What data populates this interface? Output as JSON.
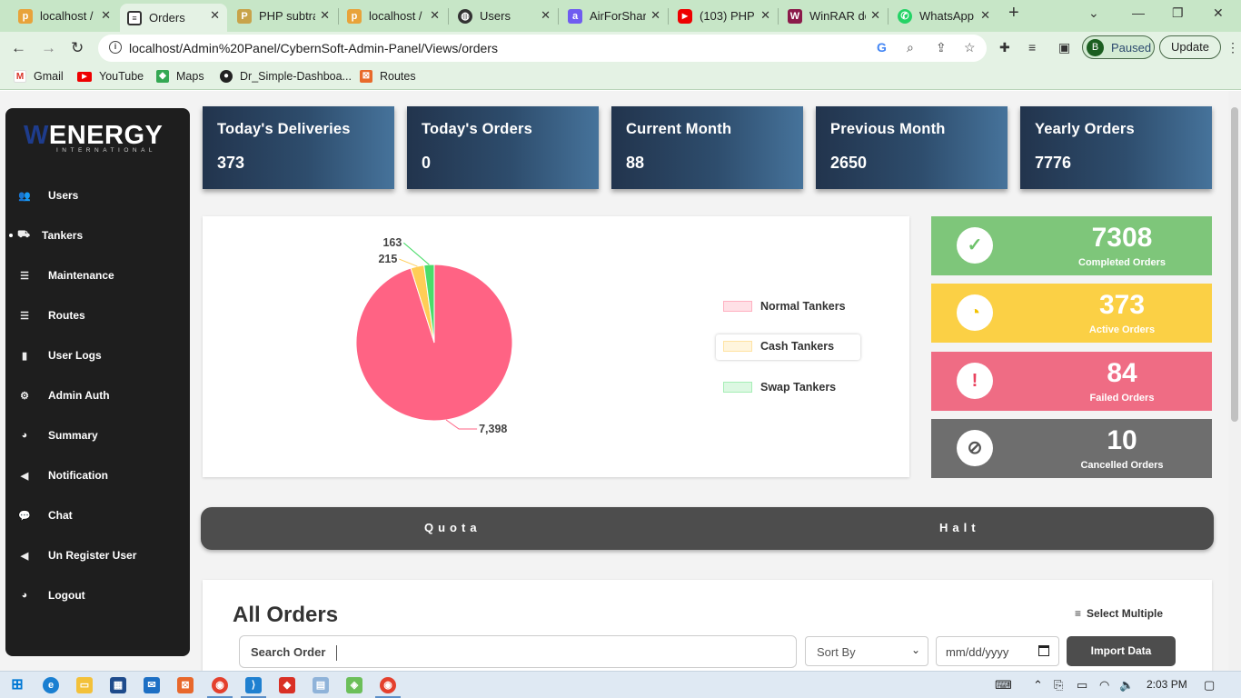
{
  "browser": {
    "tabs": [
      {
        "title": "localhost /",
        "icon": "phpmyadmin-icon"
      },
      {
        "title": "Orders",
        "icon": "orders-page-icon"
      },
      {
        "title": "PHP subtra",
        "icon": "php-icon"
      },
      {
        "title": "localhost /",
        "icon": "phpmyadmin-icon"
      },
      {
        "title": "Users",
        "icon": "globe-icon"
      },
      {
        "title": "AirForShar",
        "icon": "airforshare-icon"
      },
      {
        "title": "(103) PHP",
        "icon": "youtube-icon"
      },
      {
        "title": "WinRAR do",
        "icon": "winrar-icon"
      },
      {
        "title": "WhatsApp",
        "icon": "whatsapp-icon"
      }
    ],
    "url": "localhost/Admin%20Panel/CybernSoft-Admin-Panel/Views/orders",
    "profile_initial": "B",
    "profile_status": "Paused",
    "update_label": "Update",
    "bookmarks": [
      "Gmail",
      "YouTube",
      "Maps",
      "Dr_Simple-Dashboa...",
      "Routes"
    ]
  },
  "logo": {
    "first_letter": "W",
    "rest": "ENERGY",
    "sub": "INTERNATIONAL"
  },
  "sidebar": {
    "items": [
      {
        "label": "Users",
        "icon": "users-icon"
      },
      {
        "label": "Tankers",
        "icon": "truck-icon"
      },
      {
        "label": "Maintenance",
        "icon": "database-icon"
      },
      {
        "label": "Routes",
        "icon": "database-icon"
      },
      {
        "label": "User Logs",
        "icon": "bar-chart-icon"
      },
      {
        "label": "Admin Auth",
        "icon": "user-cog-icon"
      },
      {
        "label": "Summary",
        "icon": "pie-chart-icon"
      },
      {
        "label": "Notification",
        "icon": "bullhorn-icon"
      },
      {
        "label": "Chat",
        "icon": "chat-icon"
      },
      {
        "label": "Un Register User",
        "icon": "bullhorn-icon"
      },
      {
        "label": "Logout",
        "icon": "pie-chart-icon"
      }
    ],
    "active": "Tankers"
  },
  "cards": [
    {
      "title": "Today's Deliveries",
      "value": "373"
    },
    {
      "title": "Today's Orders",
      "value": "0"
    },
    {
      "title": "Current Month",
      "value": "88"
    },
    {
      "title": "Previous Month",
      "value": "2650"
    },
    {
      "title": "Yearly Orders",
      "value": "7776"
    }
  ],
  "chart_data": {
    "type": "pie",
    "slices": [
      {
        "label": "Normal Tankers",
        "value": 7398,
        "value_label": "7,398",
        "color": "#ff6384"
      },
      {
        "label": "Cash Tankers",
        "value": 215,
        "value_label": "215",
        "color": "#ffcd56"
      },
      {
        "label": "Swap Tankers",
        "value": 163,
        "value_label": "163",
        "color": "#4bdc6a"
      }
    ],
    "legend_position": "right"
  },
  "stats": [
    {
      "value": "7308",
      "label": "Completed Orders",
      "icon": "check-icon",
      "color": "#7ec67a",
      "icon_color": "#6ec26b"
    },
    {
      "value": "373",
      "label": "Active Orders",
      "icon": "clock-icon",
      "color": "#fbd045",
      "icon_color": "#f2c200"
    },
    {
      "value": "84",
      "label": "Failed Orders",
      "icon": "exclamation-icon",
      "color": "#ef6c84",
      "icon_color": "#e9435f"
    },
    {
      "value": "10",
      "label": "Cancelled Orders",
      "icon": "ban-icon",
      "color": "#6e6e6e",
      "icon_color": "#555555"
    }
  ],
  "quota_bar": {
    "left": "Quota",
    "right": "Halt"
  },
  "orders": {
    "title": "All Orders",
    "select_multiple": "Select Multiple",
    "search_label": "Search Order",
    "sort_placeholder": "Sort By",
    "date_placeholder": "mm/dd/yyyy",
    "import_label": "Import Data"
  },
  "taskbar": {
    "time": "2:03 PM"
  }
}
